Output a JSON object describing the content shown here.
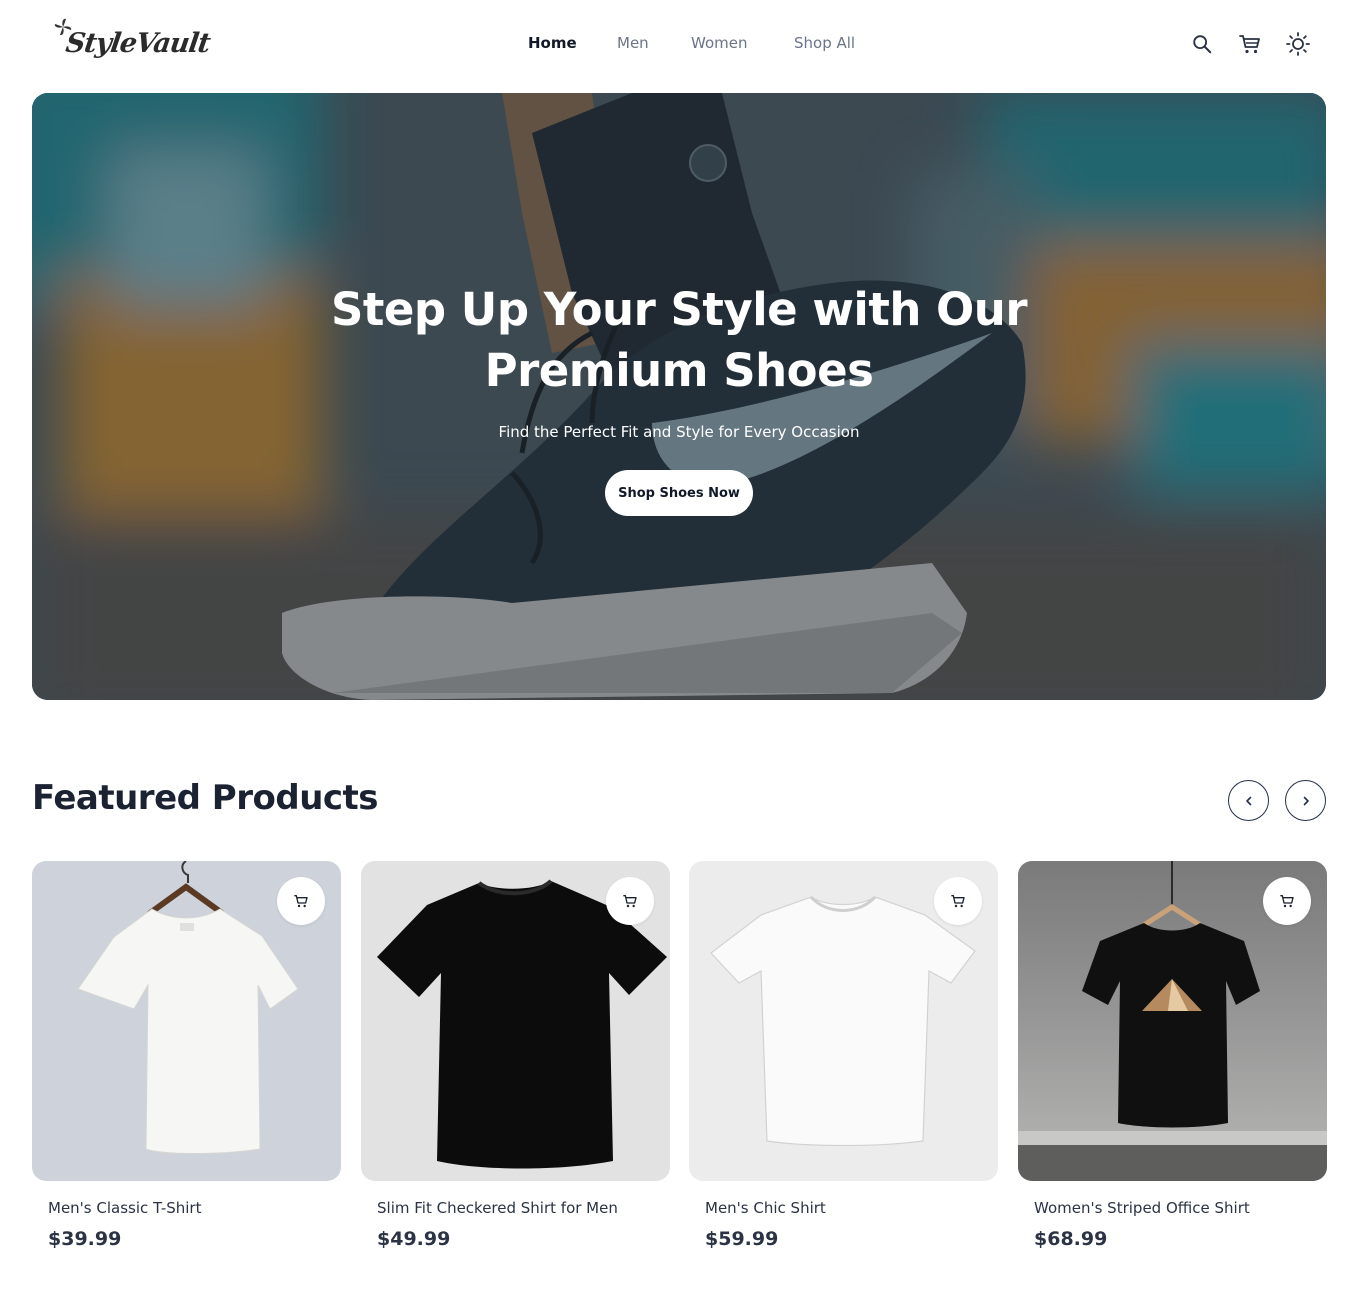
{
  "brand": {
    "name": "StyleVault"
  },
  "nav": {
    "items": [
      {
        "label": "Home",
        "active": true
      },
      {
        "label": "Men",
        "active": false
      },
      {
        "label": "Women",
        "active": false
      },
      {
        "label": "Shop All",
        "active": false
      }
    ]
  },
  "header_icons": {
    "search": "search-icon",
    "cart": "cart-icon",
    "theme": "sun-icon"
  },
  "hero": {
    "title_line1": "Step Up Your Style with Our",
    "title_line2": "Premium Shoes",
    "subtitle": "Find the Perfect Fit and Style for Every Occasion",
    "cta": "Shop Shoes Now"
  },
  "featured": {
    "title": "Featured Products",
    "products": [
      {
        "name": "Men's Classic T-Shirt",
        "price": "$39.99",
        "shirt_color": "#ffffff",
        "bg": "#ced2da"
      },
      {
        "name": "Slim Fit Checkered Shirt for Men",
        "price": "$49.99",
        "shirt_color": "#0c0c0c",
        "bg": "#e2e2e2"
      },
      {
        "name": "Men's Chic Shirt",
        "price": "$59.99",
        "shirt_color": "#ffffff",
        "bg": "#ececec"
      },
      {
        "name": "Women's Striped Office Shirt",
        "price": "$68.99",
        "shirt_color": "#111111",
        "bg": "#8a8a8a"
      }
    ]
  },
  "colors": {
    "text": "#1b2231",
    "accent": "#243049",
    "muted": "#6b7488"
  }
}
